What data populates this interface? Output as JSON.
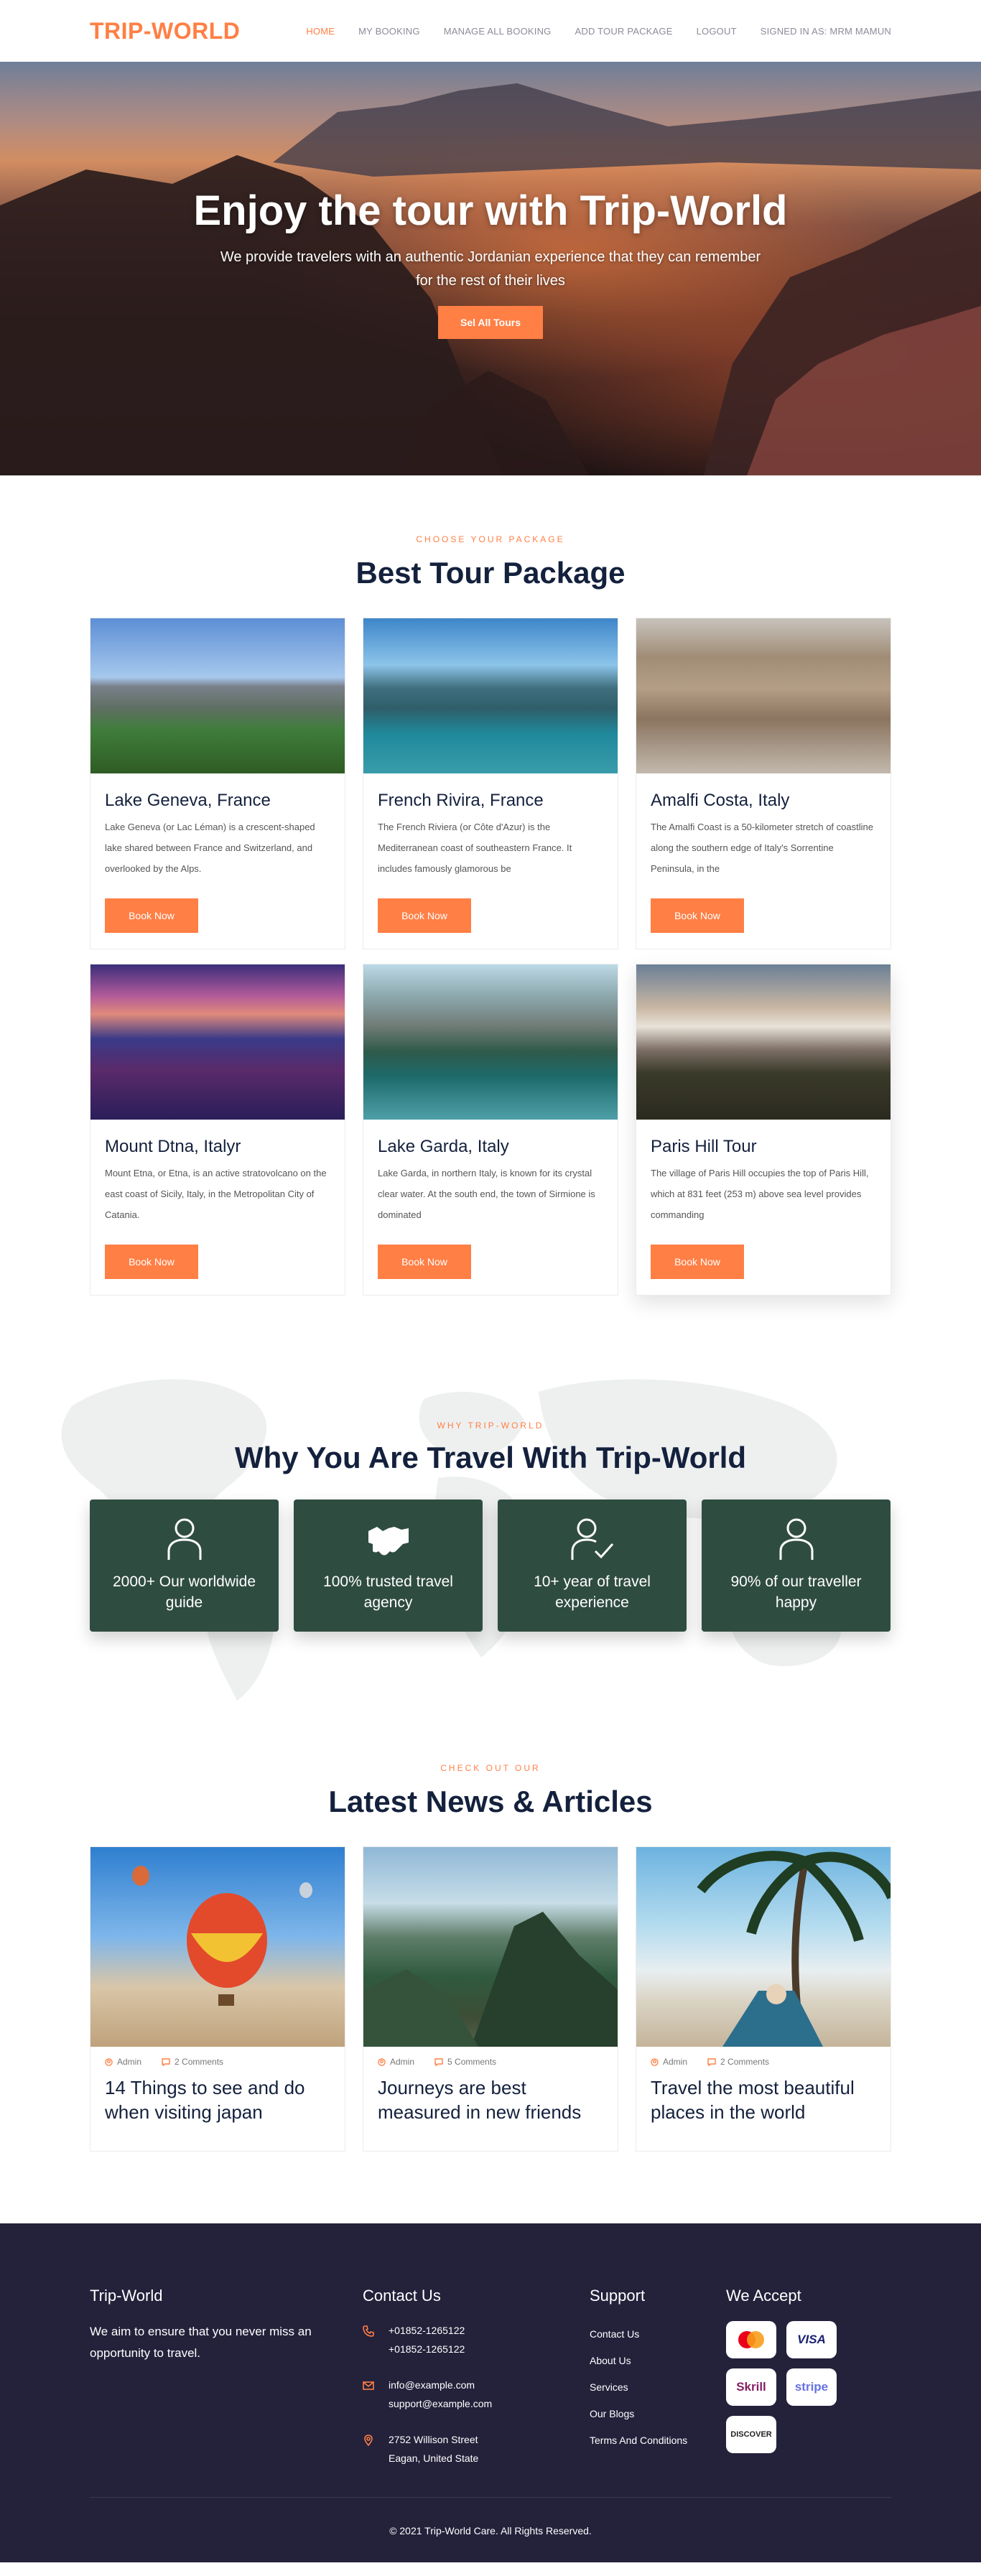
{
  "nav": {
    "logo": "TRIP-WORLD",
    "links": [
      "HOME",
      "MY BOOKING",
      "MANAGE ALL BOOKING",
      "ADD TOUR PACKAGE",
      "LOGOUT",
      "SIGNED IN AS: MRM MAMUN"
    ]
  },
  "hero": {
    "title": "Enjoy the tour with Trip-World",
    "subtitle": "We provide travelers with an authentic Jordanian experience that they can remember for the rest of their lives",
    "button": "Sel All Tours"
  },
  "packages": {
    "tag": "CHOOSE YOUR PACKAGE",
    "title": "Best Tour Package",
    "button": "Book Now",
    "items": [
      {
        "title": "Lake Geneva, France",
        "desc": "Lake Geneva (or Lac Léman) is a crescent-shaped lake shared between France and Switzerland, and overlooked by the Alps."
      },
      {
        "title": "French Rivira, France",
        "desc": "The French Riviera (or Côte d'Azur) is the Mediterranean coast of southeastern France. It includes famously glamorous be"
      },
      {
        "title": "Amalfi Costa, Italy",
        "desc": "The Amalfi Coast is a 50-kilometer stretch of coastline along the southern edge of Italy's Sorrentine Peninsula, in the"
      },
      {
        "title": "Mount Dtna, Italyr",
        "desc": "Mount Etna, or Etna, is an active stratovolcano on the east coast of Sicily, Italy, in the Metropolitan City of Catania."
      },
      {
        "title": "Lake Garda, Italy",
        "desc": "Lake Garda, in northern Italy, is known for its crystal clear water. At the south end, the town of Sirmione is dominated"
      },
      {
        "title": "Paris Hill Tour",
        "desc": "The village of Paris Hill occupies the top of Paris Hill, which at 831 feet (253 m) above sea level provides commanding"
      }
    ]
  },
  "why": {
    "tag": "WHY TRIP-WORLD",
    "title": "Why You Are Travel With Trip-World",
    "features": [
      {
        "icon": "user-icon",
        "text": "2000+ Our worldwide guide"
      },
      {
        "icon": "handshake-icon",
        "text": "100% trusted travel agency"
      },
      {
        "icon": "user-check-icon",
        "text": "10+ year of travel experience"
      },
      {
        "icon": "user-icon",
        "text": "90% of our traveller happy"
      }
    ]
  },
  "news": {
    "tag": "CHECK OUT OUR",
    "title": "Latest News & Articles",
    "items": [
      {
        "author": "Admin",
        "comments": "2 Comments",
        "title": "14 Things to see and do when visiting japan"
      },
      {
        "author": "Admin",
        "comments": "5 Comments",
        "title": "Journeys are best measured in new friends"
      },
      {
        "author": "Admin",
        "comments": "2 Comments",
        "title": "Travel the most beautiful places in the world"
      }
    ]
  },
  "footer": {
    "brand": "Trip-World",
    "about": "We aim to ensure that you never miss an opportunity to travel.",
    "contact_title": "Contact Us",
    "phone": "+01852-1265122\n+01852-1265122",
    "email": "info@example.com\nsupport@example.com",
    "address": "2752 Willison Street\nEagan, United State",
    "support_title": "Support",
    "support_links": [
      "Contact Us",
      "About Us",
      "Services",
      "Our Blogs",
      "Terms And Conditions"
    ],
    "accept_title": "We Accept",
    "payments": [
      "mastercard",
      "VISA",
      "Skrill",
      "stripe",
      "DISCOVER"
    ],
    "copyright": "© 2021 Trip-World Care. All Rights Reserved."
  },
  "colors": {
    "accent": "#ff7f45",
    "navy": "#14213d",
    "feature_bg": "#2f4c41",
    "footer_bg": "#24213b"
  }
}
